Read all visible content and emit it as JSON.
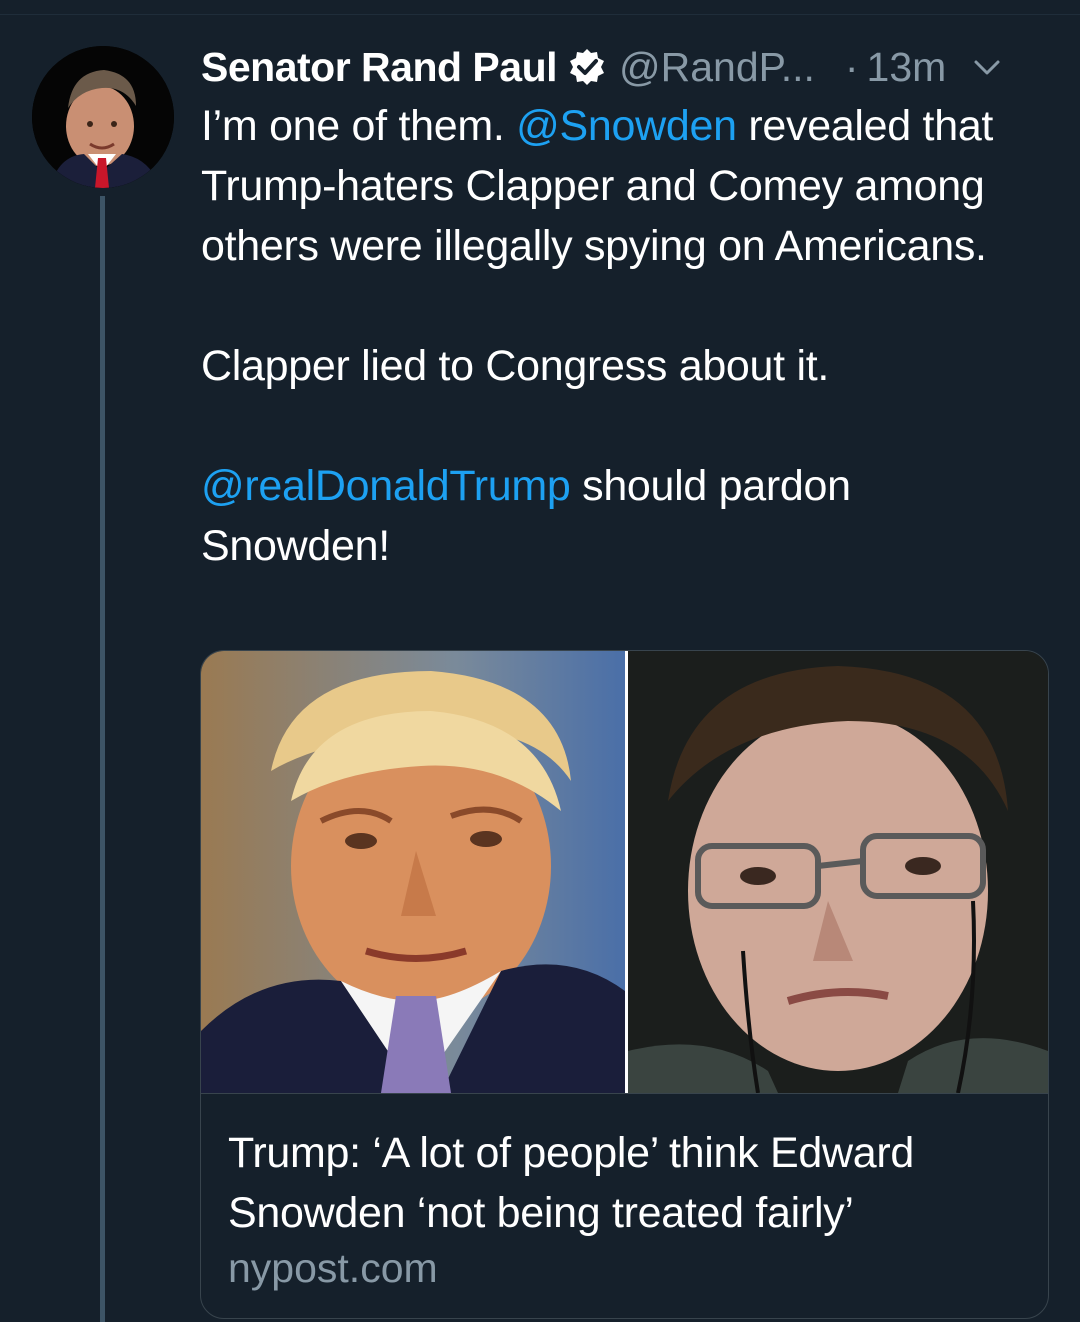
{
  "tweet": {
    "display_name": "Senator Rand Paul",
    "handle": "@RandP...",
    "separator": "·",
    "time": "13m",
    "verified_icon": "verified-badge-icon",
    "menu_icon": "chevron-down-icon",
    "text": {
      "p1_part1": "I’m one of them. ",
      "p1_mention": "@Snowden",
      "p1_part2": " revealed that Trump-haters Clapper and Comey among others were illegally spying on Americans.",
      "p2": "Clapper lied to Congress about it.",
      "p3_mention": "@realDonaldTrump",
      "p3_part2": " should pardon Snowden!"
    },
    "card": {
      "title": "Trump: ‘A lot of people’ think Edward Snowden ‘not being treated fairly’",
      "domain": "nypost.com"
    }
  },
  "colors": {
    "background": "#15202b",
    "link": "#1da1f2",
    "secondary_text": "#8899a6",
    "border": "#38444d"
  }
}
